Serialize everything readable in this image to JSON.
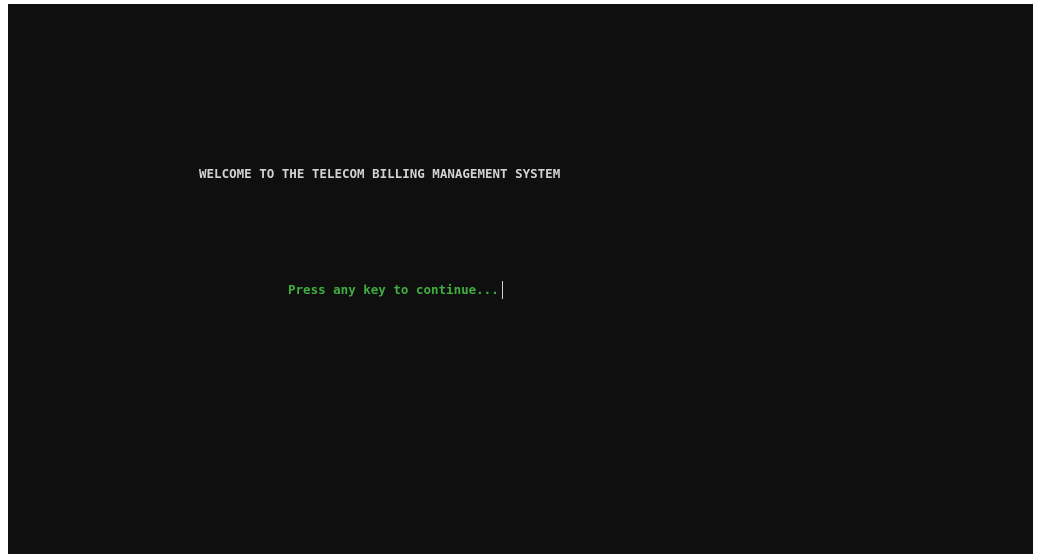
{
  "console": {
    "welcome_text": "WELCOME TO THE TELECOM BILLING MANAGEMENT SYSTEM",
    "prompt_text": "Press any key to continue...",
    "colors": {
      "background": "#0f0f0f",
      "welcome": "#d2d2d2",
      "prompt": "#3fae3f"
    }
  }
}
